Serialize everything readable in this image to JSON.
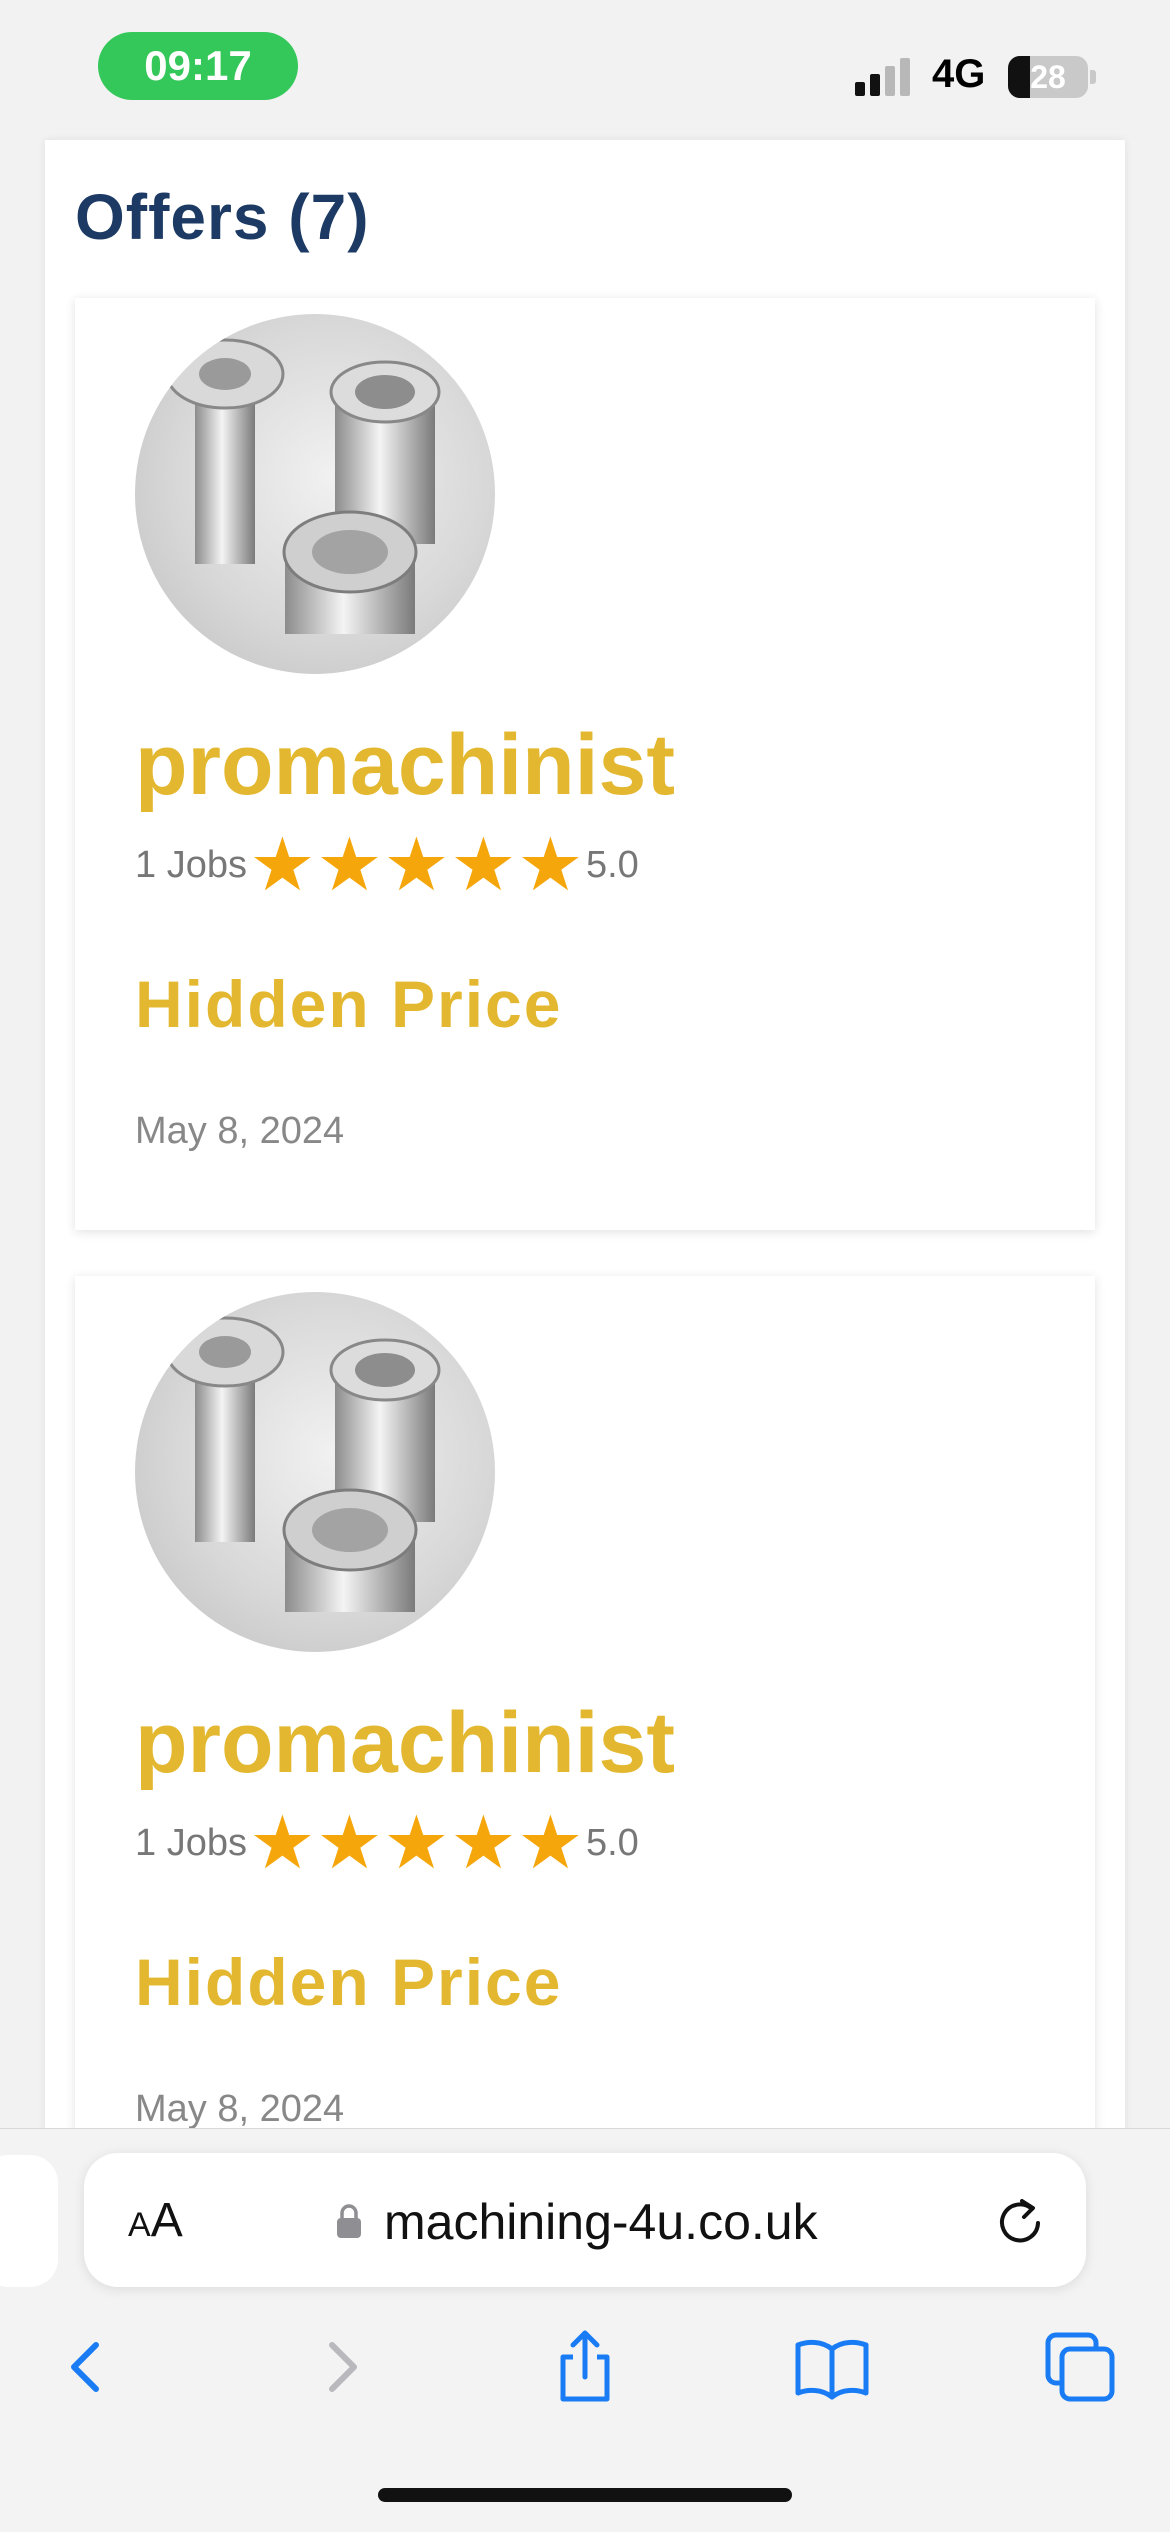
{
  "status_bar": {
    "time": "09:17",
    "network": "4G",
    "battery": "28",
    "battery_level": 0.28
  },
  "offers": {
    "title": "Offers (7)",
    "items": [
      {
        "seller": "promachinist",
        "jobs": "1 Jobs",
        "stars": 5,
        "rating": "5.0",
        "price": "Hidden Price",
        "date": "May 8, 2024"
      },
      {
        "seller": "promachinist",
        "jobs": "1 Jobs",
        "stars": 5,
        "rating": "5.0",
        "price": "Hidden Price",
        "date": "May 8, 2024"
      }
    ]
  },
  "browser": {
    "text_size_small": "A",
    "text_size_big": "A",
    "url": "machining-4u.co.uk",
    "icons": [
      "back-icon",
      "forward-icon",
      "share-icon",
      "bookmarks-icon",
      "tabs-icon",
      "reload-icon",
      "lock-icon"
    ]
  },
  "colors": {
    "accent_yellow": "#e3b830",
    "title_navy": "#1c3a63",
    "star_orange": "#f5a60a",
    "ios_blue": "#1a7cf5",
    "time_green": "#34c759"
  }
}
